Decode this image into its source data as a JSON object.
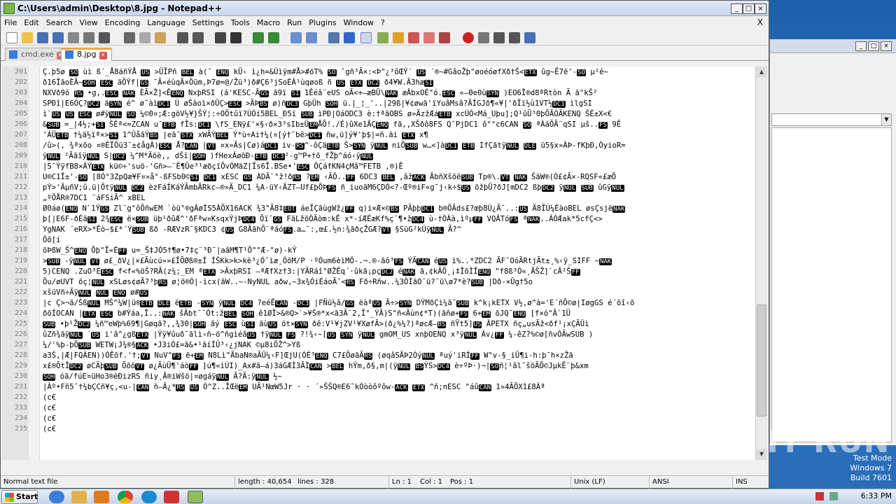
{
  "window": {
    "title": "C:\\Users\\admin\\Desktop\\8.jpg - Notepad++"
  },
  "menu": [
    "File",
    "Edit",
    "Search",
    "View",
    "Encoding",
    "Language",
    "Settings",
    "Tools",
    "Macro",
    "Run",
    "Plugins",
    "Window",
    "?"
  ],
  "menu_close": "X",
  "tabs": [
    {
      "label": "cmd.exe",
      "active": false
    },
    {
      "label": "8.jpg",
      "active": true
    }
  ],
  "lines": [
    {
      "n": "201",
      "t": "Ç.þ5ø SO ùì ß´_Å8áñÝÅ US >ÜÏPñ BEL à(¯ ENQ kÜ‹ ì¿h=&Ûìÿm#Å>#öT% SO ˆgñ³Ã×:<Þ\"¿³ôŒÝ´ US ´®~#GâoŽþ\"øoéóøfXð†Š<ETX ûg~Ë7ë'-SO µ²é~"
    },
    {
      "n": "202",
      "t": "ð16ÎãoÈÃ~SOH ESC ãÖÝf|GS ¯Ã«éùqÃ×Öüm,Þ7ø=@/Žü³)ð#Ç6³jSoÉÀ¹ùqøoß ñ US ETX DC2 ð4¥W.Ã3hæSI"
    },
    {
      "n": "203",
      "t": "NXVð9ö RS •g,.ESC NAK ÈÃ×Ž]<ÊENQ NxþRSI (á'KESC-ÃGS ã9ï SI 1Êéâ¨eUS oÄ<+—æBÜ\\NAK æÂbxOÉ\"ó.ESC «—Θe0ùSYN )EO6Î®d8ªRtòn Ã ã°kŠ²"
    },
    {
      "n": "204",
      "t": "SPÐî|E6ÓÇ?DC2 äSYN é^  ø˜àìDC1 Ú  øŠàoì×ðÛÇ>ESC >ÃÞBS ø)ñDC3 GþÛh SOH ü.|_¦_'..|29ß|¥¢øwã'ïYuâMsâ?ÃÍGJð¶«¥|'ðÏï½ù1VT½DC1 ìlgSI"
    },
    {
      "n": "205",
      "t": "ì`US US ESC ø#ÿNUL SO ¼©0¤;Æ:göV½¥}ŠÝ¦:÷OÕtûï?ÚÓí5BEL_Ð5ï SUB ìPÐ|OáODC3 è:†ªãOBS ø»ÃzžÆáETB xcÚÒ<Má_Uþu];Q¹ûÜ³0þÕÃÒÃKENQ ŠÉ±X<€"
    },
    {
      "n": "206",
      "t": "&SUB =_|4½;+SI ŠÉª<=ZCAN u¯ETB fÎs:DC1 \\fS_ENÿ£'×§‹ð×3³sIb±ÜEMÅÕ!./É)ûXe1ÂÇENQ fã,,XŠðô8FS Q¯PjDC1 ô°°c6CAN SO ªÀáÕÃ¨qSI µš..FS 9Ê"
    },
    {
      "n": "207",
      "t": "'ÁÜETB †¼ä½ïª×>SI 1^ÛåãÝBS |eä¯STX xWÃÝBEL Ý*ù÷Ai†¼(¤[ý†¯bê>DC1 ñw,ü]ý¥'þ$|=ñ.äi ETX x¶"
    },
    {
      "n": "208",
      "t": "/û>(, ¾ªxõo ¤®ÉÏÖü3¯±¢ågÀ)ESC Å?CAN |VT ¤x»Ãs|Cø)áDC1 iv-RS^-ôÇäETB Š>SYN ÿNUL niÕSUB w…<]àDC1 ETB IfÇãtÿNUL DLE ü5§x»ÀÞ-fKþÐ,ÒyioR="
    },
    {
      "n": "209",
      "t": "ÿNUL ²ÃãîÿNUL S|DC2 ¼^M*Äöè,, dŠï|SOH )fHexÁøõÐ-ETB   DC3²-g™P+†õ_fŽþ^áó‹ÿNUL"
    },
    {
      "n": "210",
      "t": "|S¯ÝÿfB8×ÀÝETX kü©÷'suö-'Gñ>—¨É¶Ûe³¹æðçïÖvÓMäZ[Ïs6Ï.BSe•'ESC ÔÇáfKN4çMâ™FETB ,®)Ê"
    },
    {
      "n": "211",
      "t": "U®C1Î±'-SO [8Ó°3ZpQæ¥F¤»å°-ßFSb0©SI DC1 xESC GS ÀDÃ`°ž!ðRS ?EM ‹ÃÔ..FF 6DC3 BEL ,âžACK ÂbñXšõëSUB Tp®\\.VT NAK ŠäW®(Ò£¢Ã×-RQSF«£æÕ"
    },
    {
      "n": "212",
      "t": "pÝ>'ÃµñV;û.ü|ÕtÿNUL DC2 èzFáÍKáÝÃmbÃRkc—®»Ä_DC1 ¼A-üY‹ÃZT—Uf£þÕÞFS ñ_iuoãM6ÇDÓ<?-Œº®iF«g¯j‹k÷$US öžþÜ?ðJ[mDC2 ßþDC2 ÿNUL SUB ûGÿNUL"
    },
    {
      "n": "213",
      "t": "„ºÕÅR®7DC1 ¨áFSiÃ^  xBEL"
    },
    {
      "n": "214",
      "t": "Ø0áø(ENQ N`1ÝGS Zl¨g°ôÕñwEM `òü°®gÀøÍS5ÀÕX16ACK ¾3\"Ã8‡EOT áeÏÇãùgWž¿FF q)i×Æ×©BS PÃþþDC1 b®ÕÃds£?œþ8Ú¿Ã¯..:US Ä8ÏÙ¼ÉàoBEL øsÇsjëNAK"
    },
    {
      "n": "215",
      "t": "þ[|E6F-ðÉãSI 2¾ESC ë×SUB üþ¹ðûÆ^'ðFªw¤KsqxÝjÞDC4 Öï¯GS FãLžöÒÃòm:kÊ     x*-íÆÉæKf%ç¨¶•žDC4 ù-†ÒÀà,ìºµFF VQÂTóFS ªNAK..ÁÓÆak*5cfÇ<>"
    },
    {
      "n": "216",
      "t": "YgNAK ´eRX>*Êò~$£*´ÝSUB ßð -RÆVzR¯§KDC3 ¢US G8ÃãhÕ¨ªáóFS.a…¯:,œ£.½n:¾ãðçŽGÆ?VT §SüG²kÚÿNUL Ã?^"
    },
    {
      "n": "217",
      "t": "Ôô[í"
    },
    {
      "n": "218",
      "t": "õÞßW_Š^ENQ Õþ\"Ï«ÉFF u=_Š‡JÓ5†¶ø•7‡ç¨³Ð¯|aâM¶T¹Ô\"\"Æ-\"ø)-kÝ"
    },
    {
      "n": "219",
      "t": ">SUB -ÿNUL VT ø£_ðV¿|×£Ãùcú»»£ÎÕØß®±Í ÍŠKk>k>kè³¿Ó¯ìæ¸ÓõM/P ·ºÓum6èìMÔ-.¬.®-ãô³FS ÝÃCAN éUS ì%..*ZDC2 ÃF¯OóÃRtjÃt±¸%‹ÿ_SIFF ~NAK"
    },
    {
      "n": "220",
      "t": "5)CENQ .ZuO³ÈESC f<f«%öŠ?RÃ(z¼;_EM ªETX >ÃxþRSI –ªÆfXz†3:|YÃRáî\"ØŽÊq´·ûkã¡pçDC2 éNAK ã,¢kÃÕ¸¡‡ÎõÌÎENQ \"f8ß³Ó«¸ÃŠŽ]`cÂ²ŠFF"
    },
    {
      "n": "221",
      "t": "Öu/øUVT õç¦NUL xSLøs¢øÃ?³þRS ø¦ö®Ó|-ìcx(ãW..~-NyNUL aðw,~3x¾ÓiÉáoÃ¯<RS Fð÷Rñw..¼3ÔÌãO¨ü?¨ü\\ø7*è?SUB |Dð-×Ûg†5o"
    },
    {
      "n": "222",
      "t": "xšüVñ÷ÃÿNUL NUL ENQ ø#US"
    },
    {
      "n": "223",
      "t": "|c Ç>¬ã/ŠßNUL MŠ^¼W|ü®ETB DLE ëETB -SYN ÿNUL DC4 ?eéÊCAN -DC3 |FÑü½â/GS ëàªUS Ä÷>SYN DÝMðÇì¼ã¯SUB k^k¡kETX V½,ø^à='E´ñÕ©ø|IøgGS é´õî‹õ"
    },
    {
      "n": "224",
      "t": "ðõÍOCAN |ETX ESC b#Ýáa,Î..:NAK šÃbt¯¨Òt:žBEL SOH ê1ØÏ>&®Q>`>¥Š®*x<ã3Ã¯2,Ï°_ÝÃ)S\"ñ<Ãùn¢*T)(ãñø+FS 6+EM õJQ¯ENQ [f×ó\"Ã`1Ü"
    },
    {
      "n": "225",
      "t": "SUB •þ¹ŽDC2 ¼ñ™eWþ%69¶|Gøqã?,,¾30|SOH ãý ESC ùSI ãùUS öt×SYN ðê:V¹¥jZV¹¥XøfÃ>(ð¿%¼?)ªøcÆ—BS ñŸt5]US ÀPETX ñç„usÃž<ðf¹¡xÇÃÛì"
    },
    {
      "n": "226",
      "t": "ûZñ¾äÿNUL ´US i'â^¿gßETX |Ýÿ¥ûuð¯ãlì›ñ~ö^ñgìéâUS †ÿNUL FS ?!¾‹~[US SYN ÿNUL gmOM_US xnþOENQ x³ÿNUL Àv¿FF ¼-êZ?%©ø[ñvÓÃwSUB )"
    },
    {
      "n": "227",
      "t": "¼/'%þ-þÕSUB WETW¡J¾®§ACK •J3iÓ£=ã&•¹ãíÍÛ³‹¿jNAK ©µ8iÕŽ^>Yß"
    },
    {
      "n": "228",
      "t": "a3Š,|Æ|FQÀEN))ÓÊõf.'†;VT NuV\"FS ë+EM N8Lì\"ÃbaN®aÃÜ¼‹F]ŒjU(ÓÉ³ENQ C7£ÕøãÃRS (øqâSÃÞ2ÒýNUL ªuý'iRÍFF W°v-§_iÜ¶i-h:þ¯h×zŽã"
    },
    {
      "n": "229",
      "t": "x£®ÕtÎDC2 øCÃþSUB ÕõõVT ø¿ÃùÜ¶'áòFF ]ú¶«ìÚI)_Ax#ã—á)3áGÆÌ3ÃÌCAN >BEL hÝm,ð§,m|(ÿNUL BSÝS>DC4 è÷ºÞ·)¬|SOñ¦¹âl¯šöÃÕ©JµkË¨þ&xm"
    },
    {
      "n": "230",
      "t": "SOH óã/fúE¤üHo3®èÐizRS ñiy¸Ã®iWšö|¤øgáÿNUL Ã?Ã:ÿNUL ½~"
    },
    {
      "n": "231",
      "t": "|Àº•Fñ5¯†¼bÇCñ¥ç,<u-|CAN ñ—Â¿*RS US Ó^Z..ÎŒëEM UÃ¹NœW5Jr · · ´»ŠŠQ®E6¯kÓòòôºôw-ACK ETX ^ñ;nESC \"áûCAN 1»4ÃÕX1£8Àª"
    },
    {
      "n": "232",
      "t": "(c€"
    },
    {
      "n": "233",
      "t": "(c€"
    },
    {
      "n": "234",
      "t": "(c€"
    },
    {
      "n": "235",
      "t": "(c€"
    }
  ],
  "status": {
    "filetype": "Normal text file",
    "length": "length : 40,654",
    "lines": "lines : 328",
    "ln": "Ln : 1",
    "col": "Col : 1",
    "pos": "Pos : 1",
    "eol": "Unix (LF)",
    "encoding": "ANSI",
    "mode": "INS"
  },
  "watermark": "ANY RUN",
  "test_mode": {
    "line1": "Test Mode",
    "line2": "Windows 7",
    "line3": "Build 7601"
  },
  "taskbar": {
    "start_label": "Start",
    "clock": "6:33 PM"
  },
  "colors": {
    "accent_tab": "#f9a43d",
    "control_char_bg": "#000000"
  }
}
